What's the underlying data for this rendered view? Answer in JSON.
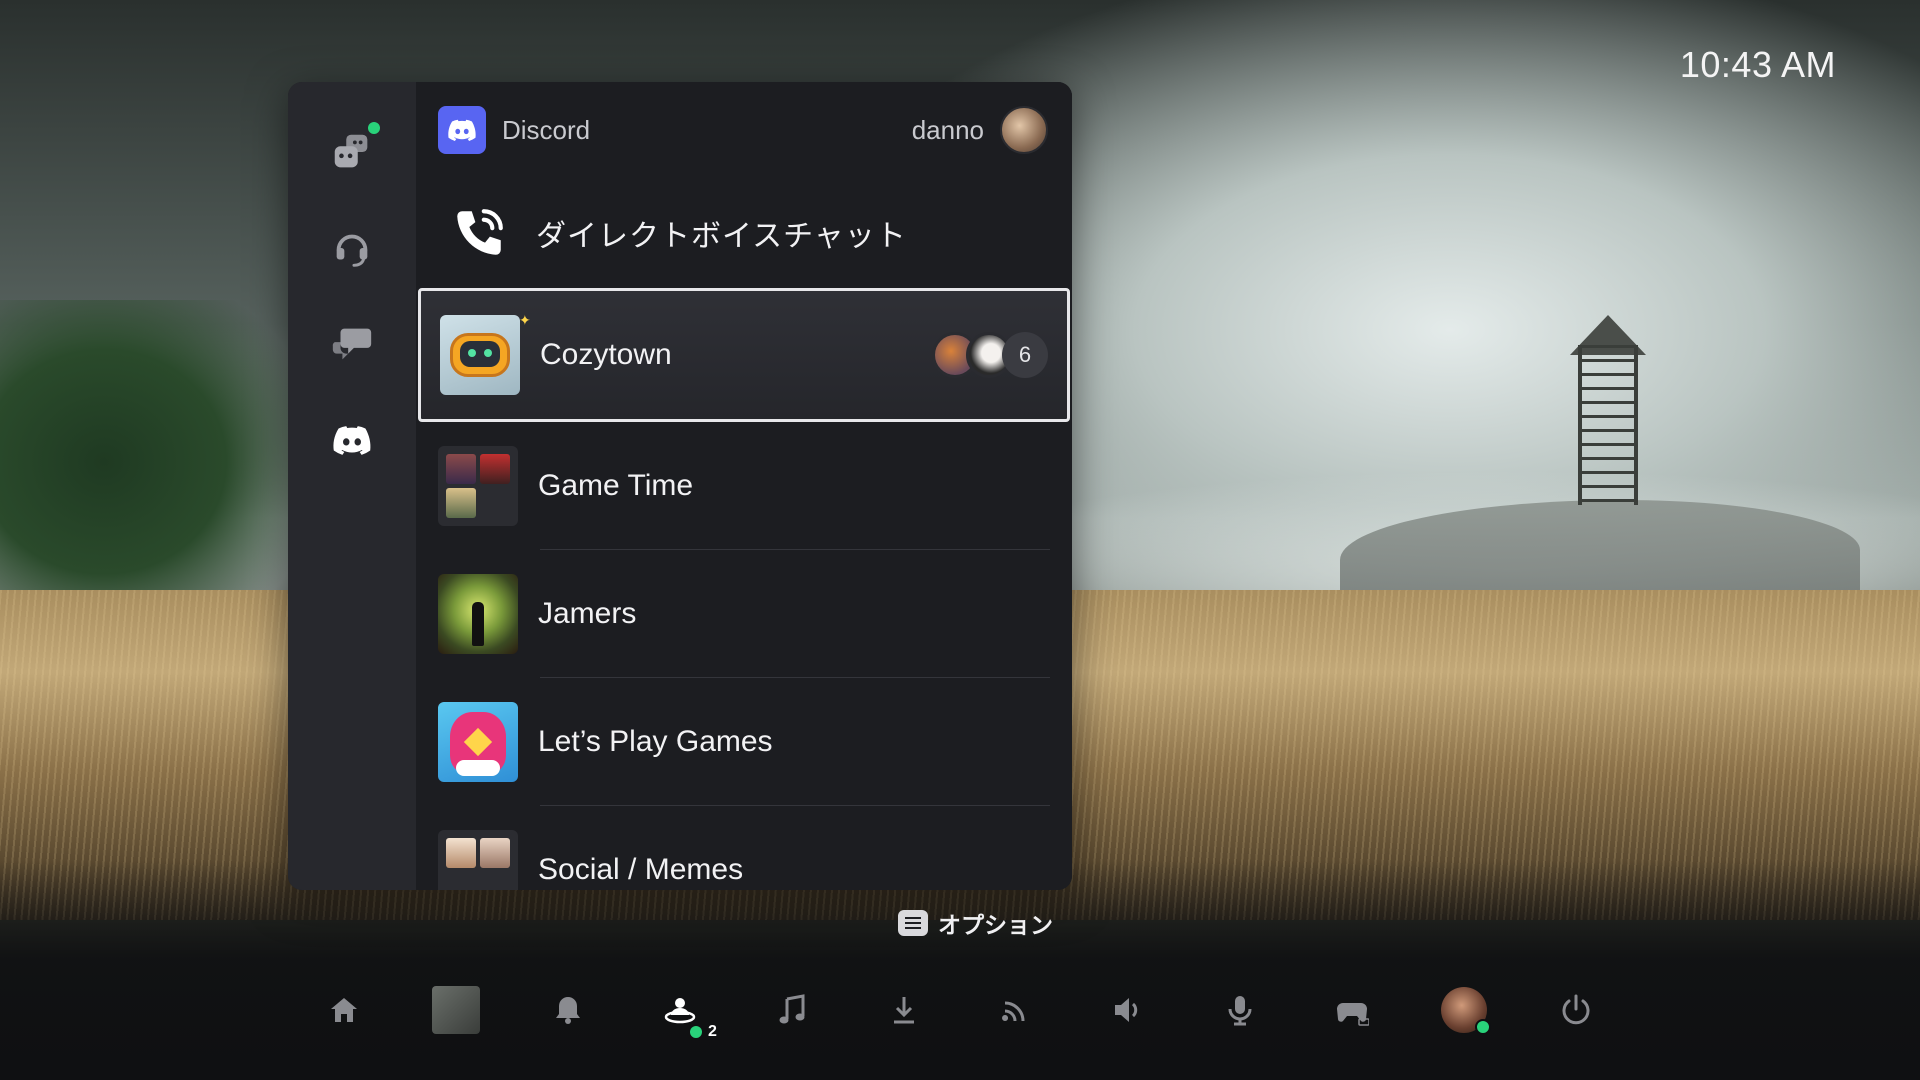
{
  "clock": "10:43 AM",
  "colors": {
    "discord_brand": "#5865f2",
    "online_status": "#29d27a",
    "panel_bg": "#1c1d21",
    "rail_bg": "#27282d"
  },
  "rail": {
    "items": [
      {
        "name": "game-base-icon",
        "has_status_dot": true
      },
      {
        "name": "headset-icon"
      },
      {
        "name": "messages-icon"
      },
      {
        "name": "discord-icon",
        "selected": true
      }
    ]
  },
  "header": {
    "app_name": "Discord",
    "username": "danno"
  },
  "direct_voice_chat": {
    "label": "ダイレクトボイスチャット",
    "icon": "phone-call-icon"
  },
  "servers": [
    {
      "name": "Cozytown",
      "selected": true,
      "member_count": "6"
    },
    {
      "name": "Game Time"
    },
    {
      "name": "Jamers"
    },
    {
      "name": "Let’s Play Games"
    },
    {
      "name": "Social / Memes"
    }
  ],
  "options_hint": {
    "label": "オプション",
    "icon": "options-button-icon"
  },
  "control_bar": {
    "items": [
      "home-icon",
      "game-tile",
      "bell-icon",
      "game-base-icon",
      "music-icon",
      "download-icon",
      "remote-play-icon",
      "volume-icon",
      "mic-icon",
      "controller-icon",
      "avatar",
      "power-icon"
    ],
    "game_base_badge": "2"
  }
}
